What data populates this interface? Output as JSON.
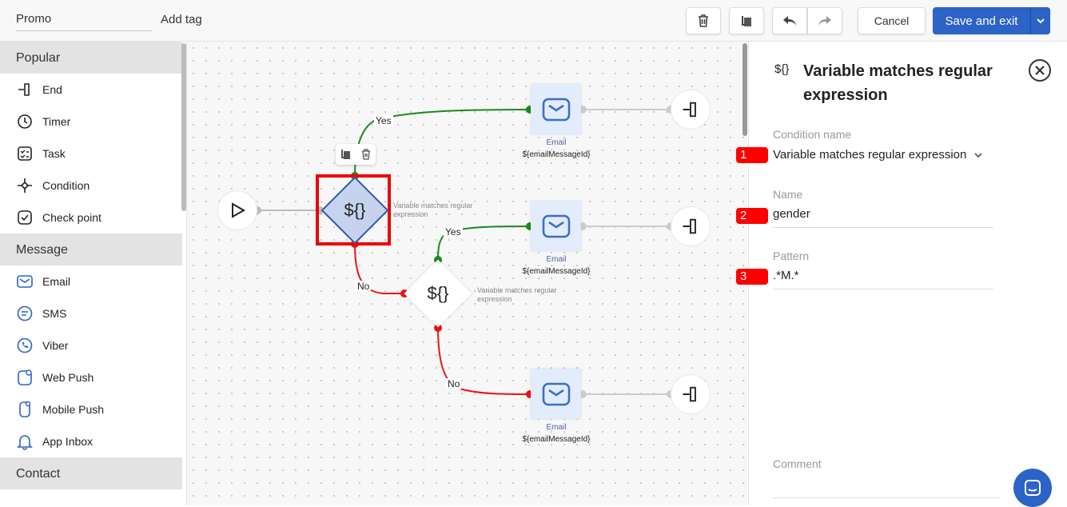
{
  "header": {
    "title": "Promo",
    "add_tag": "Add tag",
    "cancel": "Cancel",
    "save": "Save and exit"
  },
  "sidebar": {
    "sections": [
      {
        "title": "Popular",
        "items": [
          {
            "label": "End",
            "icon": "end-icon"
          },
          {
            "label": "Timer",
            "icon": "timer-icon"
          },
          {
            "label": "Task",
            "icon": "task-icon"
          },
          {
            "label": "Condition",
            "icon": "condition-icon"
          },
          {
            "label": "Check point",
            "icon": "check-point-icon"
          }
        ]
      },
      {
        "title": "Message",
        "items": [
          {
            "label": "Email",
            "icon": "email-icon"
          },
          {
            "label": "SMS",
            "icon": "sms-icon"
          },
          {
            "label": "Viber",
            "icon": "viber-icon"
          },
          {
            "label": "Web Push",
            "icon": "web-push-icon"
          },
          {
            "label": "Mobile Push",
            "icon": "mobile-push-icon"
          },
          {
            "label": "App Inbox",
            "icon": "app-inbox-icon"
          }
        ]
      },
      {
        "title": "Contact",
        "items": []
      }
    ]
  },
  "canvas": {
    "condition_symbol": "${}",
    "condition_label": "Variable matches regular expression",
    "yes": "Yes",
    "no": "No",
    "email_type": "Email",
    "email_id": "${emailMessageId}"
  },
  "panel": {
    "icon": "${}",
    "title": "Variable matches regular expression",
    "condition_name_label": "Condition name",
    "condition_name": "Variable matches regular expression",
    "name_label": "Name",
    "name": "gender",
    "pattern_label": "Pattern",
    "pattern": ".*M.*",
    "comment_label": "Comment",
    "badges": [
      "1",
      "2",
      "3"
    ]
  },
  "colors": {
    "accent": "#2b63c6",
    "yes": "#1a8a1a",
    "no": "#e11",
    "highlight": "#e00"
  }
}
